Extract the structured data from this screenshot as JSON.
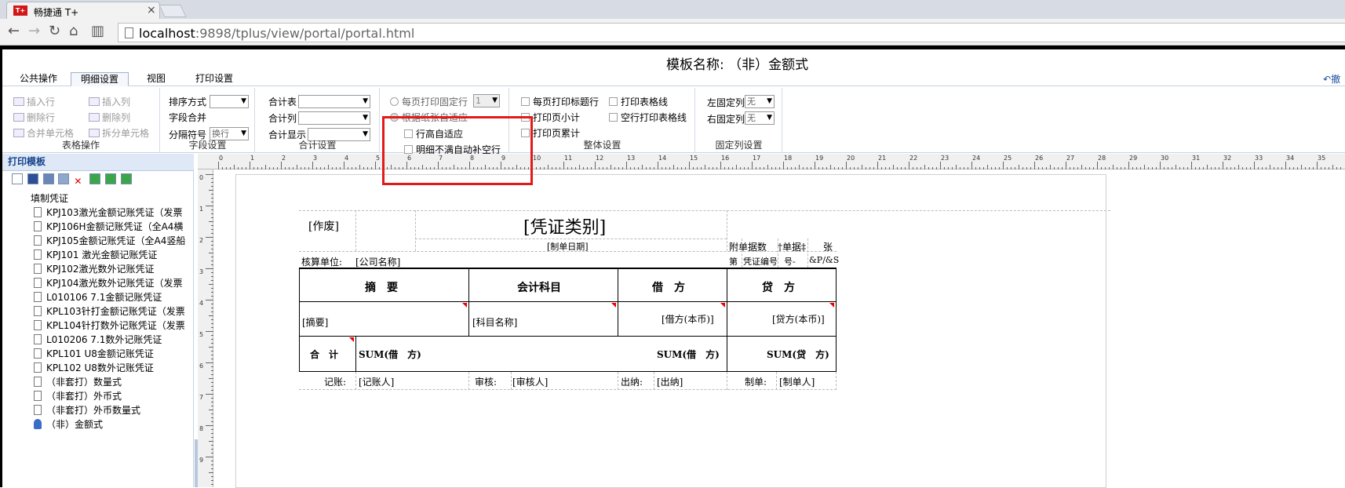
{
  "browser": {
    "tab_title": "畅捷通 T+",
    "tab_logo": "T+",
    "url_host": "localhost",
    "url_rest": ":9898/tplus/view/portal/portal.html"
  },
  "header": {
    "template_name": "模板名称: （非）金额式"
  },
  "ribbon_tabs": [
    {
      "label": "公共操作"
    },
    {
      "label": "明细设置"
    },
    {
      "label": "视图"
    },
    {
      "label": "打印设置"
    }
  ],
  "undo_label": "撤",
  "ribbon": {
    "table_ops": {
      "title": "表格操作",
      "insert_row": "插入行",
      "insert_col": "插入列",
      "delete_row": "删除行",
      "delete_col": "删除列",
      "merge_cells": "合并单元格",
      "split_cells": "拆分单元格"
    },
    "field_settings": {
      "title": "字段设置",
      "sort_label": "排序方式",
      "sort_value": "",
      "merge_label": "字段合并",
      "sep_label": "分隔符号",
      "sep_value": "换行"
    },
    "total_settings": {
      "title": "合计设置",
      "total_table_label": "合计表",
      "total_col_label": "合计列",
      "total_show_label": "合计显示"
    },
    "fixed_rows": {
      "per_page_fixed": "每页打印固定行",
      "per_page_value": "1",
      "fit_paper": "根据纸张自适应",
      "row_height_auto": "行高自适应",
      "detail_fill": "明细不满自动补空行"
    },
    "overall": {
      "title": "整体设置",
      "print_title_row": "每页打印标题行",
      "print_table_lines": "打印表格线",
      "page_subtotal": "打印页小计",
      "empty_row_lines": "空行打印表格线",
      "page_cumulative": "打印页累计"
    },
    "fixed_cols": {
      "title": "固定列设置",
      "left_label": "左固定列",
      "left_value": "无",
      "right_label": "右固定列",
      "right_value": "无"
    }
  },
  "sidebar": {
    "title": "打印模板",
    "root": "填制凭证",
    "items": [
      {
        "label": "KPJ103激光金额记账凭证（发票"
      },
      {
        "label": "KPJ106H金额记账凭证（全A4横"
      },
      {
        "label": "KPJ105金额记账凭证（全A4竖船"
      },
      {
        "label": "KPJ101 激光金额记账凭证"
      },
      {
        "label": "KPJ102激光数外记账凭证"
      },
      {
        "label": "KPJ104激光数外记账凭证（发票"
      },
      {
        "label": "L010106 7.1金额记账凭证"
      },
      {
        "label": "KPL103针打金额记账凭证（发票"
      },
      {
        "label": "KPL104针打数外记账凭证（发票"
      },
      {
        "label": "L010206 7.1数外记账凭证"
      },
      {
        "label": "KPL101 U8金额记账凭证"
      },
      {
        "label": "KPL102 U8数外记账凭证"
      },
      {
        "label": "（非套打）数量式"
      },
      {
        "label": "（非套打）外币式"
      },
      {
        "label": "（非套打）外币数量式"
      },
      {
        "label": "（非）金额式"
      }
    ]
  },
  "ruler": {
    "h_numbers": [
      "0",
      "1",
      "2",
      "3",
      "4",
      "5",
      "6",
      "7",
      "8",
      "9",
      "10",
      "11",
      "12",
      "13",
      "14",
      "15",
      "16",
      "17",
      "18",
      "19",
      "20",
      "21",
      "22",
      "23",
      "24",
      "25",
      "26",
      "27",
      "28",
      "29",
      "30",
      "31",
      "32",
      "33",
      "34",
      "35"
    ],
    "v_numbers": [
      "0",
      "1",
      "2",
      "3",
      "4",
      "5",
      "6",
      "7",
      "8",
      "9"
    ]
  },
  "voucher": {
    "void_label": "[作废]",
    "category": "[凭证类别]",
    "date": "[制单日期]",
    "attach_label": "附单据数",
    "attach_value": "†单据‡",
    "attach_unit": "张",
    "unit_label": "核算单位:",
    "company": "[公司名称]",
    "no_prefix": "第",
    "no_label": "凭证编号",
    "no_suffix": "号-",
    "page_code": "&P/&S",
    "col_summary": "摘　要",
    "col_account": "会计科目",
    "col_debit": "借　方",
    "col_credit": "贷　方",
    "summary": "[摘要]",
    "account": "[科目名称]",
    "debit": "[借方(本币)]",
    "credit": "[贷方(本币)]",
    "total_label": "合　计",
    "total_sum": "SUM(借　方)",
    "debit_sum": "SUM(借　方)",
    "credit_sum": "SUM(贷　方)",
    "bookkeeper_label": "记账:",
    "bookkeeper": "[记账人]",
    "reviewer_label": "审核:",
    "reviewer": "[审核人]",
    "cashier_label": "出纳:",
    "cashier": "[出纳]",
    "maker_label": "制单:",
    "maker": "[制单人]"
  }
}
